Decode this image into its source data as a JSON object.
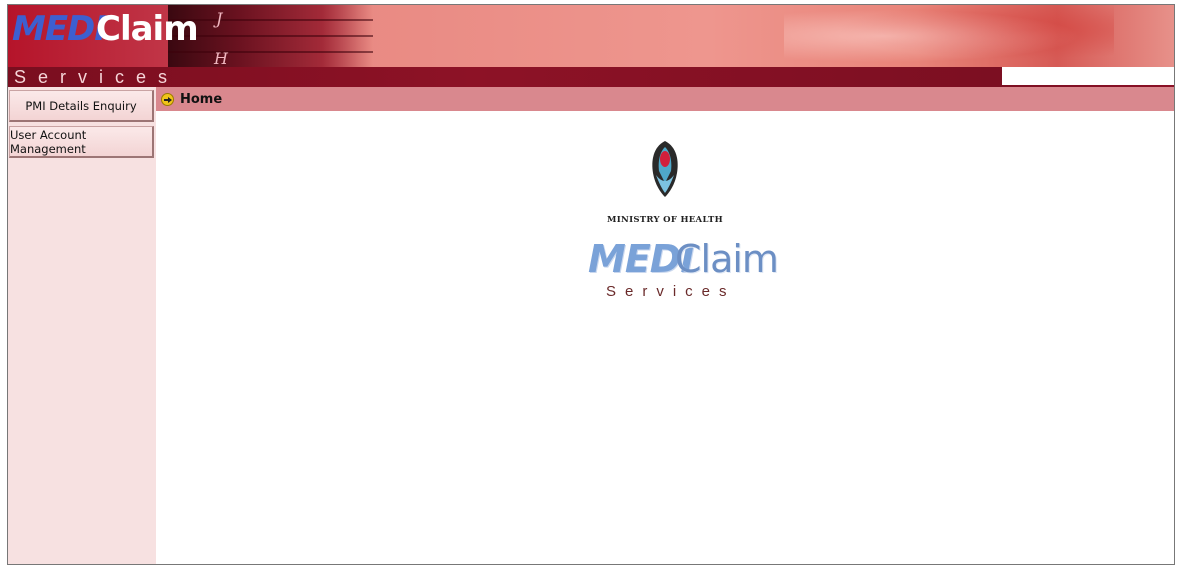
{
  "header": {
    "logo_medi": "MEDI",
    "logo_claim": "Claim",
    "logo_services": "Services",
    "key_letters": [
      "J",
      "H"
    ]
  },
  "sidebar": {
    "items": [
      {
        "label": "PMI Details Enquiry"
      },
      {
        "label": "User Account Management"
      }
    ]
  },
  "breadcrumb": {
    "current": "Home",
    "icon": "arrow-right-circle-icon"
  },
  "main": {
    "organization": "MINISTRY OF HEALTH",
    "logo_medi": "MEDI",
    "logo_claim": "Claim",
    "logo_services": "Services"
  },
  "colors": {
    "banner_stripe": "#8d1226",
    "breadcrumb_bar": "#d9888e",
    "sidebar_bg": "#f7e1e1",
    "logo_blue": "#3d5fd0"
  }
}
